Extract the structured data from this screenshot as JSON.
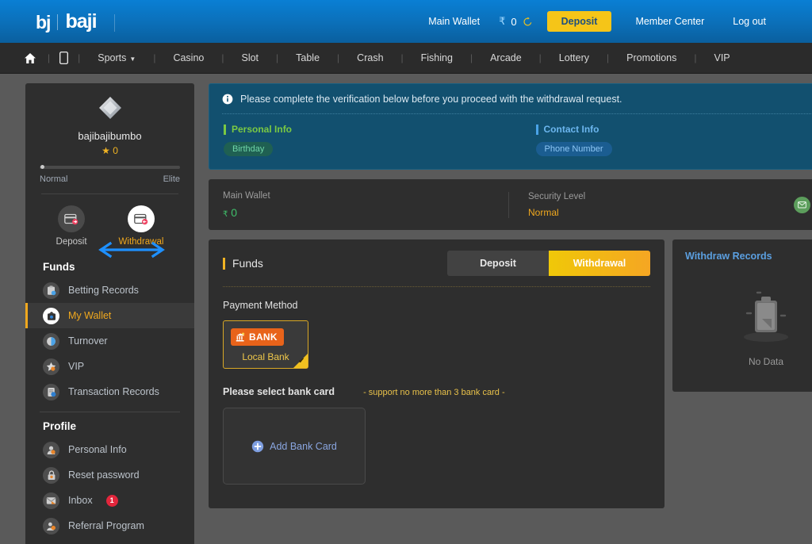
{
  "header": {
    "logo_bj": "bj",
    "logo_baji": "baji",
    "wallet_label": "Main Wallet",
    "currency_symbol": "₹",
    "balance": "0",
    "refresh_icon": "refresh-icon",
    "deposit_label": "Deposit",
    "member_center_label": "Member Center",
    "logout_label": "Log out"
  },
  "nav": {
    "home_icon": "home-icon",
    "mobile_icon": "mobile-icon",
    "items": [
      {
        "label": "Sports",
        "caret": "⌄"
      },
      {
        "label": "Casino"
      },
      {
        "label": "Slot"
      },
      {
        "label": "Table"
      },
      {
        "label": "Crash"
      },
      {
        "label": "Fishing"
      },
      {
        "label": "Arcade"
      },
      {
        "label": "Lottery"
      },
      {
        "label": "Promotions"
      },
      {
        "label": "VIP"
      }
    ],
    "divider": "|"
  },
  "sidebar": {
    "username": "bajibajibumbo",
    "star_icon": "star-icon",
    "star_count": "0",
    "level_low": "Normal",
    "level_high": "Elite",
    "actions": [
      {
        "label": "Deposit",
        "icon": "deposit-card-icon",
        "active": false
      },
      {
        "label": "Withdrawal",
        "icon": "withdrawal-card-icon",
        "active": true
      }
    ],
    "sections": [
      {
        "title": "Funds",
        "items": [
          {
            "label": "Betting Records",
            "icon": "betting-records-icon",
            "active": false
          },
          {
            "label": "My Wallet",
            "icon": "wallet-icon",
            "active": true
          },
          {
            "label": "Turnover",
            "icon": "turnover-icon",
            "active": false
          },
          {
            "label": "VIP",
            "icon": "vip-star-icon",
            "active": false
          },
          {
            "label": "Transaction Records",
            "icon": "transaction-records-icon",
            "active": false
          }
        ]
      },
      {
        "title": "Profile",
        "items": [
          {
            "label": "Personal Info",
            "icon": "person-icon",
            "active": false
          },
          {
            "label": "Reset password",
            "icon": "lock-icon",
            "active": false
          },
          {
            "label": "Inbox",
            "icon": "mail-icon",
            "active": false,
            "badge": "1"
          },
          {
            "label": "Referral Program",
            "icon": "referral-icon",
            "active": false
          }
        ]
      }
    ]
  },
  "banner": {
    "info_icon": "info-icon",
    "message": "Please complete the verification below before you proceed with the withdrawal request.",
    "columns": [
      {
        "title": "Personal Info",
        "accent": "#7ac943",
        "chip": "Birthday",
        "chip_style": "green"
      },
      {
        "title": "Contact Info",
        "accent": "#4aa3e8",
        "chip": "Phone Number",
        "chip_style": "blue"
      }
    ]
  },
  "wallet_strip": {
    "main_wallet_label": "Main Wallet",
    "currency_symbol": "₹",
    "balance": "0",
    "security_label": "Security Level",
    "security_value": "Normal",
    "mail_icon": "mail-verify-icon",
    "phone_icon": "phone-verify-icon"
  },
  "funds": {
    "title": "Funds",
    "tabs": [
      {
        "label": "Deposit",
        "active": false
      },
      {
        "label": "Withdrawal",
        "active": true
      }
    ],
    "payment_method_label": "Payment Method",
    "payment_methods": [
      {
        "badge_text": "BANK",
        "name": "Local Bank",
        "icon": "bank-building-icon",
        "selected": true
      }
    ],
    "select_card_label": "Please select bank card",
    "select_card_hint": "- support no more than 3 bank card -",
    "add_card_label": "Add Bank Card",
    "add_card_icon": "plus-circle-icon"
  },
  "records": {
    "title": "Withdraw Records",
    "empty_icon": "clipboard-empty-icon",
    "empty_text": "No Data"
  },
  "annotation": {
    "arrow_icon": "double-arrow-annotation",
    "color": "#1e90ff"
  },
  "colors": {
    "brand_blue": "#0b6fb8",
    "accent_yellow": "#f5c518",
    "accent_orange": "#f0a81e",
    "danger_red": "#e3263c",
    "success_green": "#3fbf6a"
  }
}
